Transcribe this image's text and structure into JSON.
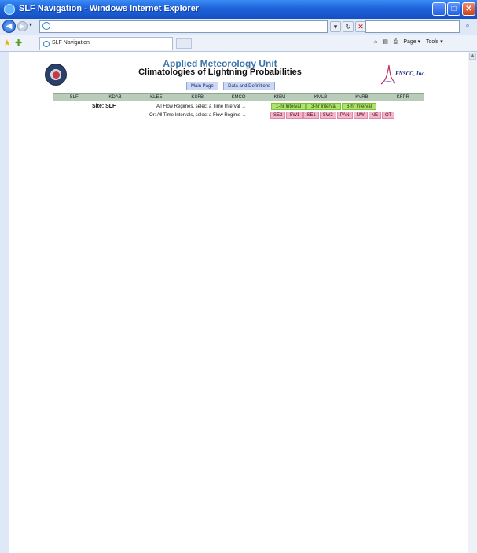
{
  "window": {
    "title": "SLF Navigation - Windows Internet Explorer",
    "min_label": "–",
    "max_label": "□",
    "close_label": "✕"
  },
  "tab": {
    "label": "SLF Navigation"
  },
  "toolbar": {
    "home_label": "⌂",
    "feeds_label": "▤",
    "print_label": "⎙",
    "page_label": "Page ▾",
    "tools_label": "Tools ▾"
  },
  "header": {
    "title": "Applied Meteorology Unit",
    "subtitle": "Climatologies of Lightning Probabilities",
    "company": "ENSCO, Inc."
  },
  "nav_buttons": [
    {
      "label": "Main Page"
    },
    {
      "label": "Data and Definitions"
    }
  ],
  "sites": [
    "SLF",
    "KDAB",
    "KLEE",
    "KSFB",
    "KMCO",
    "KISM",
    "KMLB",
    "KVRB",
    "KFPR"
  ],
  "site_label": "Site: SLF",
  "row1_label": "All Flow Regimes, select a Time Interval →",
  "row2_label": "Or: All Time Intervals, select a Flow Regime →",
  "intervals": [
    "1-hr Interval",
    "3-hr Interval",
    "6-hr Interval"
  ],
  "regimes": [
    "SE2",
    "SW1",
    "SE1",
    "SW2",
    "PAN",
    "NW",
    "NE",
    "OT"
  ],
  "colors": {
    "interval_button": "#aee46c",
    "regime_button": "#f4b6c8",
    "site_bar": "#b9cbb9",
    "title_blue": "#3b74a8"
  }
}
